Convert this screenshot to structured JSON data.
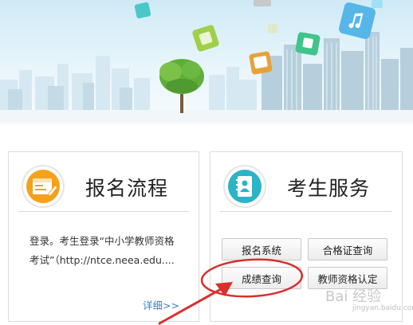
{
  "registration_card": {
    "title": "报名流程",
    "description_line1": "登录。考生登录“中小学教师资格",
    "description_line2": "考试”（http://ntce.neea.edu....",
    "more_link": "详细>>",
    "icon": "form-edit-icon"
  },
  "services_card": {
    "title": "考生服务",
    "icon": "address-book-icon",
    "buttons": {
      "registration_system": "报名系统",
      "certificate_query": "合格证查询",
      "score_query": "成绩查询",
      "qualification_certification": "教师资格认定"
    }
  },
  "watermark": {
    "text": "Bai 经验",
    "subtext": "jingyan.baidu.com"
  },
  "colors": {
    "annotation_red": "#d9302c",
    "registration_icon_orange": "#f5a11c",
    "services_icon_teal": "#2bb3c6",
    "link_blue": "#3a7fc4"
  }
}
